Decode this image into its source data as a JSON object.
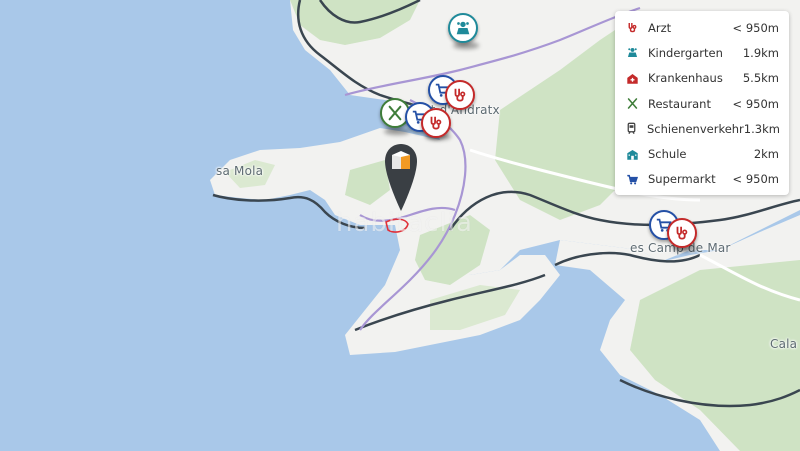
{
  "map": {
    "places": {
      "port_andratx": "Port d'Andratx",
      "sa_mola": "sa Mola",
      "camp_de_mar": "es Camp de Mar",
      "cala": "Cala"
    },
    "watermark": "habitaclia",
    "colors": {
      "water": "#a9c8e9",
      "land": "#f2f2f0",
      "forest": "#cfe3c4",
      "road_main": "#a896d4",
      "boundary": "#3a4650",
      "area_outline": "#e0323b",
      "marker": "#3a3f44",
      "marker_accent": "#f29a23"
    }
  },
  "pois": [
    {
      "type": "Kindergarten",
      "icon": "kindergarten-icon",
      "color": "#1f8a9a"
    },
    {
      "type": "Restaurant",
      "icon": "restaurant-icon",
      "color": "#3f7d3a"
    },
    {
      "type": "Supermarkt",
      "icon": "supermarket-icon",
      "color": "#2450a6"
    },
    {
      "type": "Arzt",
      "icon": "doctor-icon",
      "color": "#c42a2a"
    },
    {
      "type": "Arzt",
      "icon": "doctor-icon",
      "color": "#c42a2a"
    },
    {
      "type": "Supermarkt",
      "icon": "supermarket-icon",
      "color": "#2450a6"
    },
    {
      "type": "Arzt",
      "icon": "doctor-icon",
      "color": "#c42a2a"
    }
  ],
  "legend": {
    "items": [
      {
        "label": "Arzt",
        "distance": "< 950m",
        "icon": "doctor-icon",
        "color": "#c42a2a"
      },
      {
        "label": "Kindergarten",
        "distance": "1.9km",
        "icon": "kindergarten-icon",
        "color": "#1f8a9a"
      },
      {
        "label": "Krankenhaus",
        "distance": "5.5km",
        "icon": "hospital-icon",
        "color": "#c42a2a"
      },
      {
        "label": "Restaurant",
        "distance": "< 950m",
        "icon": "restaurant-icon",
        "color": "#3f7d3a"
      },
      {
        "label": "Schienenverkehr",
        "distance": "1.3km",
        "icon": "train-icon",
        "color": "#444444"
      },
      {
        "label": "Schule",
        "distance": "2km",
        "icon": "school-icon",
        "color": "#1f8a9a"
      },
      {
        "label": "Supermarkt",
        "distance": "< 950m",
        "icon": "supermarket-icon",
        "color": "#2450a6"
      }
    ]
  }
}
